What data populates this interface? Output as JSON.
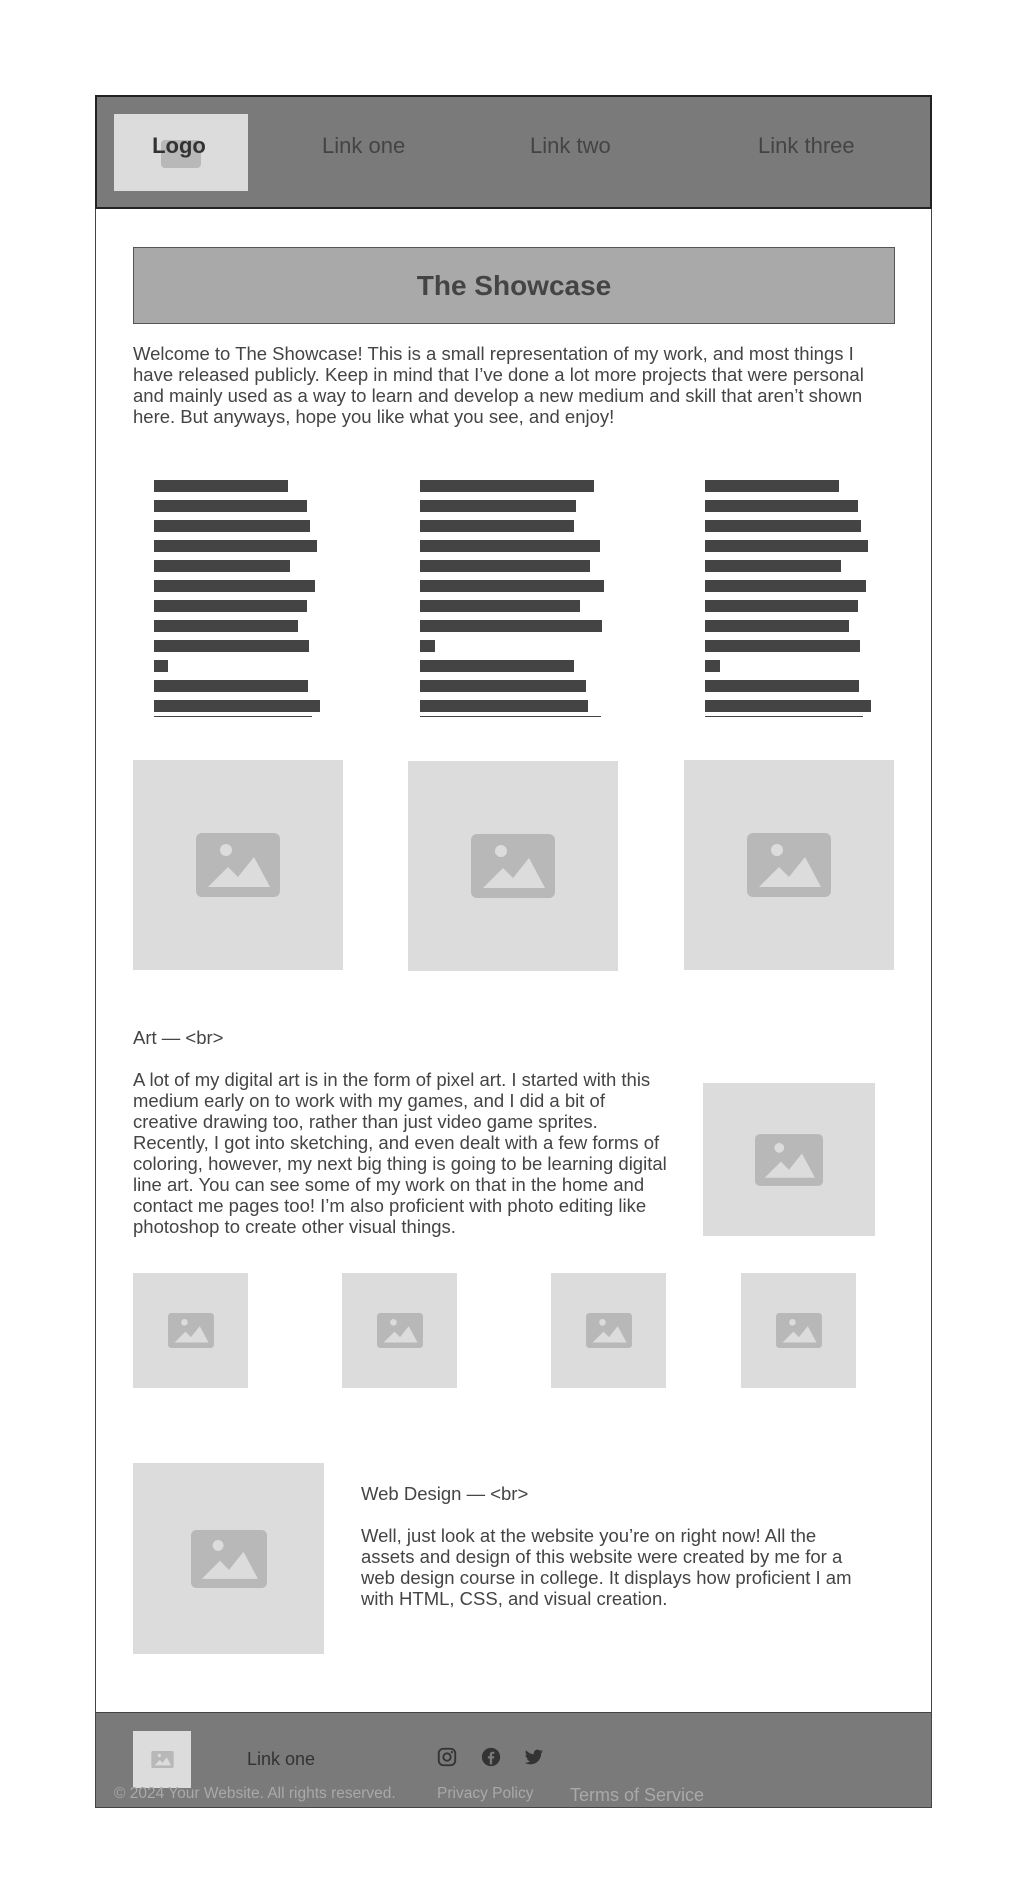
{
  "header": {
    "logo_label": "Logo",
    "nav": [
      "Link one",
      "Link two",
      "Link three"
    ]
  },
  "hero": {
    "title": "The Showcase",
    "intro": "Welcome to The Showcase! This is a small representation of my work, and most things I have released publicly. Keep in mind that I’ve done a lot more projects that were personal and mainly used as a way to learn and develop a new medium and skill that aren’t shown here. But anyways, hope you like what you see, and enjoy!"
  },
  "art": {
    "title": "Art — <br>",
    "body": "A lot of my digital art is in the form of pixel art. I started with this medium early on to work with my games, and I did a bit of creative drawing too, rather than just video game sprites. Recently, I got into sketching, and even dealt with a few forms of coloring, however, my next big thing is going to be learning digital line art. You can see some of my work on that in the home and contact me pages too! I’m also proficient with photo editing like photoshop to create other visual things."
  },
  "web_design": {
    "title": "Web Design — <br>",
    "body": "Well, just look at the website you’re on right now! All the assets and design of this website were created by me for a web design course in college. It displays how proficient I am with HTML, CSS, and visual creation."
  },
  "footer": {
    "link": "Link one",
    "social_icons": [
      "instagram-icon",
      "facebook-icon",
      "twitter-icon"
    ],
    "copyright": "© 2024 Your Website. All rights reserved.",
    "privacy": "Privacy Policy",
    "terms": "Terms of Service"
  },
  "colors": {
    "header_bg": "#7a7a7a",
    "title_bg": "#a9a9a9",
    "placeholder_bg": "#dcdcdc",
    "placeholder_icon": "#b8b8b8",
    "text": "#444444"
  }
}
